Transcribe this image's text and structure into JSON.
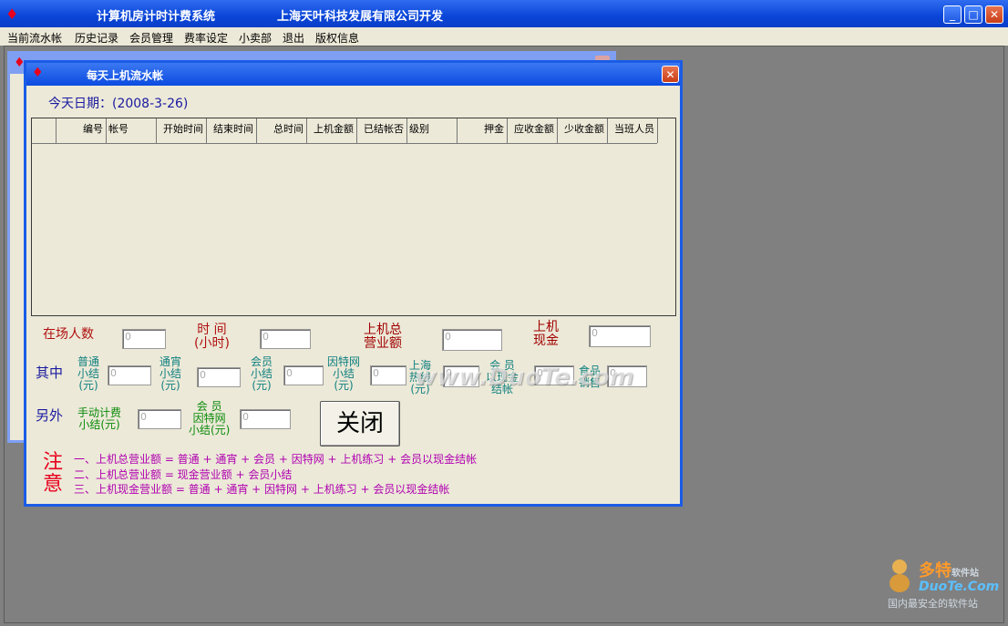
{
  "window": {
    "title_left": "计算机房计时计费系统",
    "title_right": "上海天叶科技发展有限公司开发",
    "controls": {
      "minimize": "_",
      "maximize": "□",
      "close": "✕"
    }
  },
  "menu": [
    "当前流水帐",
    "历史记录",
    "会员管理",
    "费率设定",
    "小卖部",
    "退出",
    "版权信息"
  ],
  "dialog": {
    "title": "每天上机流水帐",
    "close_glyph": "✕",
    "date_label": "今天日期：(2008-3-26)",
    "columns": [
      "编号",
      "帐号",
      "开始时间",
      "结束时间",
      "总时间",
      "上机金额",
      "已结帐否",
      "级别",
      "押金",
      "应收金额",
      "少收金额",
      "当班人员"
    ],
    "stats": {
      "present_label": "在场人数",
      "time_label_1": "时  间",
      "time_label_2": "(小时)",
      "revenue_label_1": "上机总",
      "revenue_label_2": "营业额",
      "cash_label_1": "上机",
      "cash_label_2": "现金",
      "present_value": "0",
      "time_value": "0",
      "revenue_value": "0",
      "cash_value": "0"
    },
    "breakdown": {
      "row_label": "其中",
      "normal": [
        "普通",
        "小结",
        "(元)"
      ],
      "overnight": [
        "通宵",
        "小结",
        "(元)"
      ],
      "member": [
        "会员",
        "小结",
        "(元)"
      ],
      "internet": [
        "因特网",
        "小结",
        "(元)"
      ],
      "hotline": [
        "上海",
        "热线",
        "(元)"
      ],
      "member_cash": [
        "会  员",
        "以现金",
        "结帐"
      ],
      "food": [
        "食品",
        "销售"
      ],
      "values": [
        "0",
        "0",
        "0",
        "0",
        "0",
        "0",
        "0"
      ]
    },
    "extra": {
      "row_label": "另外",
      "manual": [
        "手动计费",
        "小结(元)"
      ],
      "member_net": [
        "会  员",
        "因特网",
        "小结(元)"
      ],
      "values": [
        "0",
        "0"
      ]
    },
    "close_button": "关闭",
    "notes": {
      "big_1": "注",
      "big_2": "意",
      "line1": "一、上机总营业额 = 普通 + 通宵 + 会员 + 因特网 + 上机练习 + 会员以现金结帐",
      "line2": "二、上机总营业额 = 现金营业额 + 会员小结",
      "line3": "三、上机现金营业额 = 普通 + 通宵 + 因特网 + 上机练习  + 会员以现金结帐"
    }
  },
  "watermark": "www.DuoTe.com",
  "logo": {
    "line1": "多特",
    "line1_small": "软件站",
    "line2": "DuoTe.Com",
    "line3": "国内最安全的软件站"
  }
}
